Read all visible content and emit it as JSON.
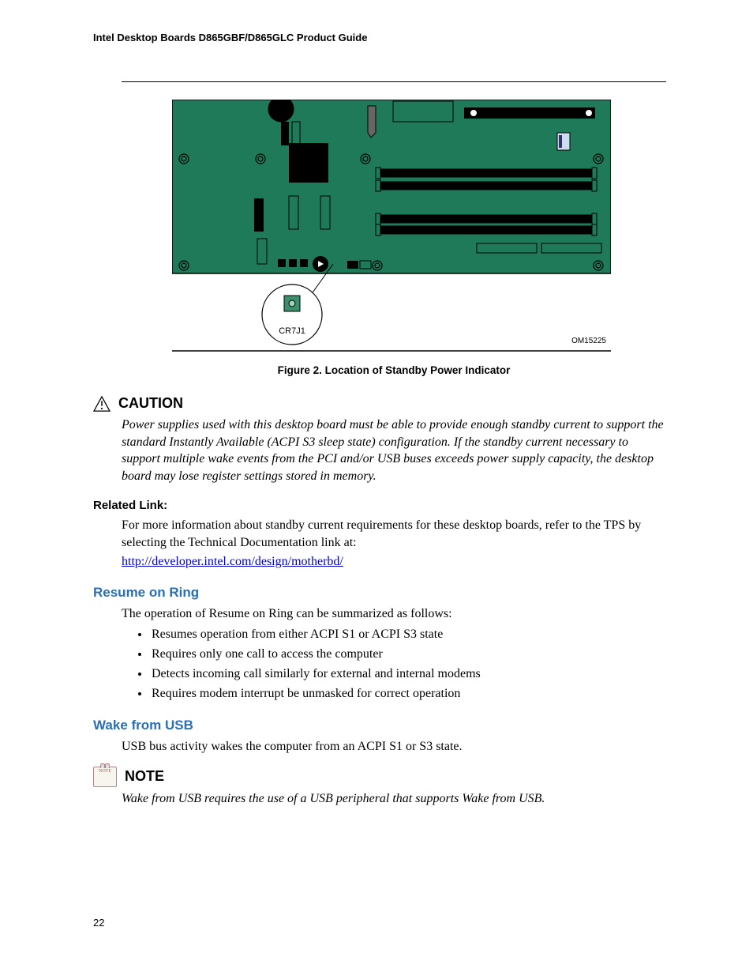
{
  "header": "Intel Desktop Boards D865GBF/D865GLC Product Guide",
  "figure": {
    "callout_label": "CR7J1",
    "om_label": "OM15225",
    "caption": "Figure 2.  Location of Standby Power Indicator"
  },
  "caution": {
    "title": "CAUTION",
    "body": "Power supplies used with this desktop board must be able to provide enough standby current to support the standard Instantly Available (ACPI S3 sleep state) configuration.  If the standby current necessary to support multiple wake events from the PCI and/or USB buses exceeds power supply capacity, the desktop board may lose register settings stored in memory."
  },
  "related_link": {
    "heading": "Related Link:",
    "body": "For more information about standby current requirements for these desktop boards, refer to the TPS by selecting the Technical Documentation link at:",
    "url": "http://developer.intel.com/design/motherbd/"
  },
  "resume_on_ring": {
    "heading": "Resume on Ring",
    "intro": "The operation of Resume on Ring can be summarized as follows:",
    "bullets": [
      "Resumes operation from either ACPI S1 or ACPI S3 state",
      "Requires only one call to access the computer",
      "Detects incoming call similarly for external and internal modems",
      "Requires modem interrupt be unmasked for correct operation"
    ]
  },
  "wake_from_usb": {
    "heading": "Wake from USB",
    "body": "USB bus activity wakes the computer from an ACPI S1 or S3 state."
  },
  "note": {
    "icon_text": "NOTE",
    "title": "NOTE",
    "body": "Wake from USB requires the use of a USB peripheral that supports Wake from USB."
  },
  "page_number": "22"
}
